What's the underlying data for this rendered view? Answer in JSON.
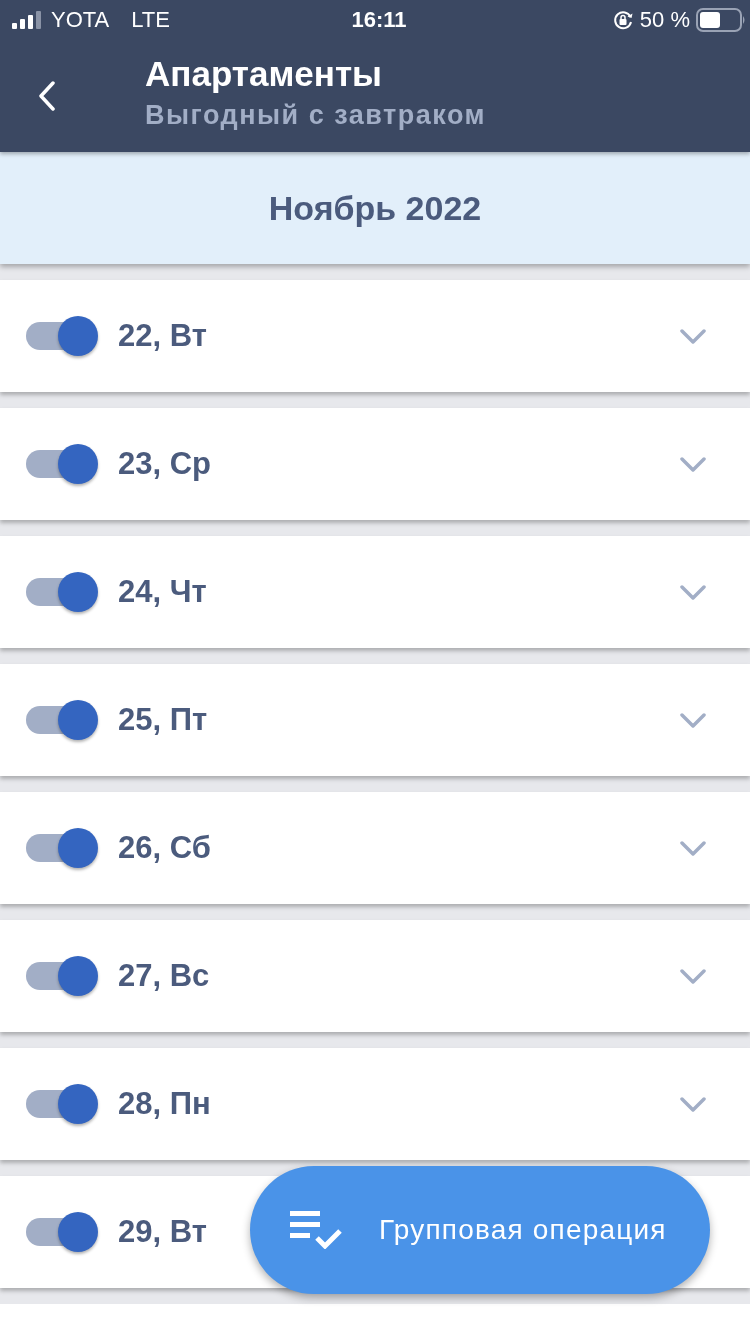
{
  "status_bar": {
    "carrier": "YOTA",
    "network": "LTE",
    "time": "16:11",
    "battery_text": "50 %"
  },
  "header": {
    "title": "Апартаменты",
    "subtitle": "Выгодный с завтраком"
  },
  "month": "Ноябрь 2022",
  "days": [
    {
      "label": "22, Вт",
      "on": true,
      "expanded": false
    },
    {
      "label": "23, Ср",
      "on": true,
      "expanded": false
    },
    {
      "label": "24, Чт",
      "on": true,
      "expanded": false
    },
    {
      "label": "25, Пт",
      "on": true,
      "expanded": false
    },
    {
      "label": "26, Сб",
      "on": true,
      "expanded": false
    },
    {
      "label": "27, Вс",
      "on": true,
      "expanded": false
    },
    {
      "label": "28, Пн",
      "on": true,
      "expanded": false
    },
    {
      "label": "29, Вт",
      "on": true
    }
  ],
  "fab": {
    "label": "Групповая операция"
  }
}
